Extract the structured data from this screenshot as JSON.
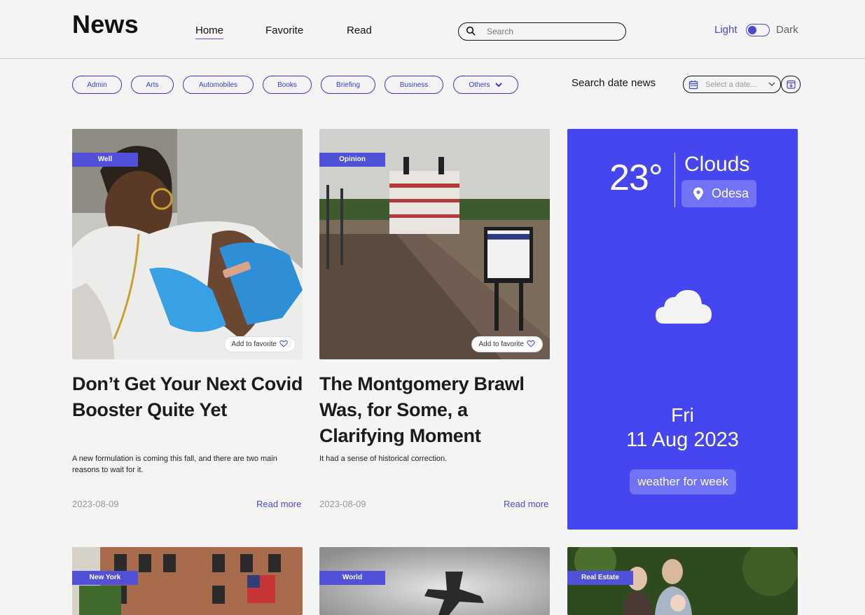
{
  "header": {
    "logo": "News",
    "nav": [
      {
        "label": "Home",
        "active": true
      },
      {
        "label": "Favorite",
        "active": false
      },
      {
        "label": "Read",
        "active": false
      }
    ],
    "search_placeholder": "Search",
    "theme": {
      "light_label": "Light",
      "dark_label": "Dark",
      "mode": "light"
    }
  },
  "categories": [
    "Admin",
    "Arts",
    "Automobiles",
    "Books",
    "Briefing",
    "Business"
  ],
  "others_label": "Others",
  "date_filter": {
    "label": "Search date news",
    "placeholder": "Select a date..."
  },
  "articles": [
    {
      "tag": "Well",
      "title": "Don’t Get Your Next Covid Booster Quite Yet",
      "description": "A new formulation is coming this fall, and there are two main reasons to wait for it.",
      "date": "2023-08-09",
      "read_more": "Read more",
      "favorite_label": "Add to favorite"
    },
    {
      "tag": "Opinion",
      "title": "The Montgomery Brawl Was, for Some, a Clarifying Moment",
      "description": "It had a sense of historical correction.",
      "date": "2023-08-09",
      "read_more": "Read more",
      "favorite_label": "Add to favorite"
    }
  ],
  "weather": {
    "temperature": "23°",
    "condition": "Clouds",
    "city": "Odesa",
    "day": "Fri",
    "date": "11 Aug 2023",
    "week_button": "weather for week",
    "condition_icon": "cloud-icon",
    "bg_color": "#4646f0"
  },
  "bottom_articles": [
    {
      "tag": "New York"
    },
    {
      "tag": "World"
    },
    {
      "tag": "Real Estate"
    }
  ],
  "colors": {
    "accent": "#4a4ad0",
    "tag_bg": "#5050d8",
    "background": "#f4f4f4"
  }
}
